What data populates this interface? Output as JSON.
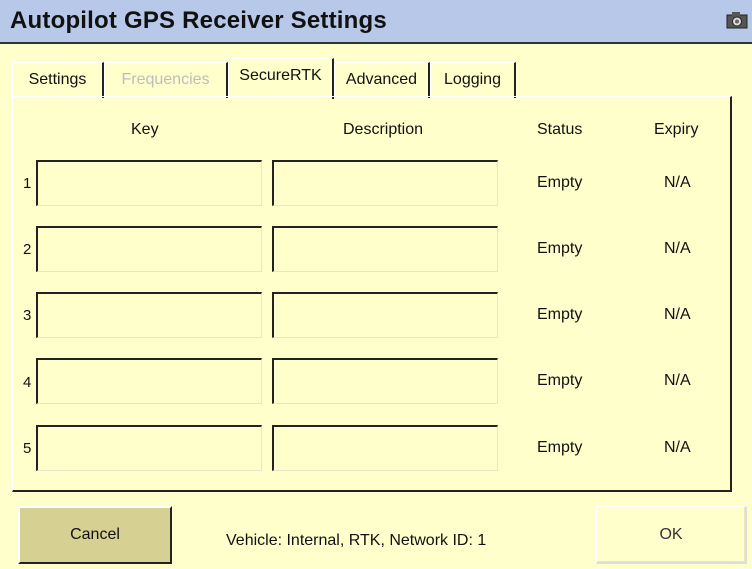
{
  "window": {
    "title": "Autopilot GPS Receiver Settings",
    "camera_icon": "camera-icon"
  },
  "tabs": [
    {
      "label": "Settings",
      "state": "normal"
    },
    {
      "label": "Frequencies",
      "state": "disabled"
    },
    {
      "label": "SecureRTK",
      "state": "active"
    },
    {
      "label": "Advanced",
      "state": "normal"
    },
    {
      "label": "Logging",
      "state": "normal"
    }
  ],
  "table": {
    "headers": {
      "key": "Key",
      "description": "Description",
      "status": "Status",
      "expiry": "Expiry"
    },
    "rows": [
      {
        "num": "1",
        "key": "",
        "description": "",
        "status": "Empty",
        "expiry": "N/A"
      },
      {
        "num": "2",
        "key": "",
        "description": "",
        "status": "Empty",
        "expiry": "N/A"
      },
      {
        "num": "3",
        "key": "",
        "description": "",
        "status": "Empty",
        "expiry": "N/A"
      },
      {
        "num": "4",
        "key": "",
        "description": "",
        "status": "Empty",
        "expiry": "N/A"
      },
      {
        "num": "5",
        "key": "",
        "description": "",
        "status": "Empty",
        "expiry": "N/A"
      }
    ]
  },
  "footer": {
    "cancel_label": "Cancel",
    "vehicle_info": "Vehicle: Internal, RTK, Network ID: 1",
    "ok_label": "OK"
  },
  "colors": {
    "background": "#ffffcc",
    "titlebar": "#b8c8e8",
    "cancel_button": "#d6d093"
  }
}
